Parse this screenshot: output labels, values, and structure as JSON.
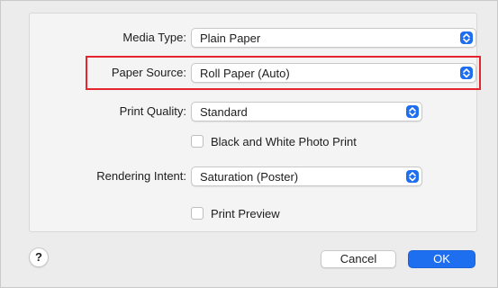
{
  "form": {
    "media_type": {
      "label": "Media Type:",
      "value": "Plain Paper"
    },
    "paper_source": {
      "label": "Paper Source:",
      "value": "Roll Paper (Auto)"
    },
    "print_quality": {
      "label": "Print Quality:",
      "value": "Standard"
    },
    "bw_photo": {
      "label": "Black and White Photo Print",
      "checked": false
    },
    "rendering_intent": {
      "label": "Rendering Intent:",
      "value": "Saturation (Poster)"
    },
    "print_preview": {
      "label": "Print Preview",
      "checked": false
    }
  },
  "footer": {
    "help_label": "?",
    "cancel_label": "Cancel",
    "ok_label": "OK"
  },
  "colors": {
    "accent": "#1e6ff0",
    "highlight": "#e5262f"
  },
  "icons": {
    "popup_stepper": "chevron-up-down-icon",
    "help": "question-mark-icon"
  }
}
